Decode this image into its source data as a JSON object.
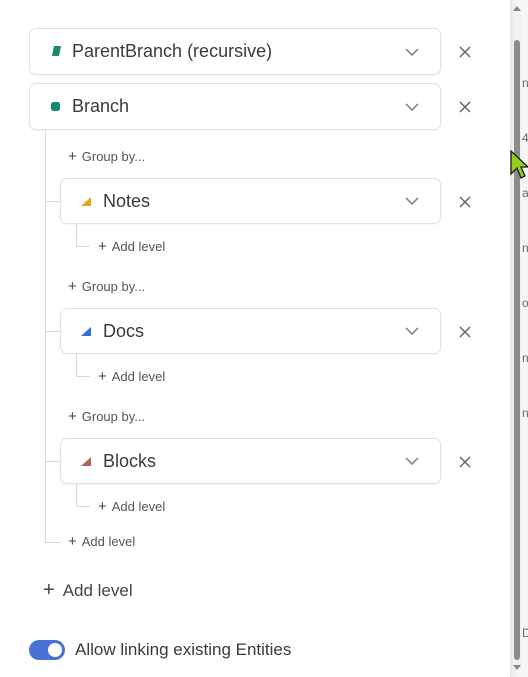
{
  "rows": {
    "parent_branch": {
      "label": "ParentBranch (recursive)",
      "icon": "parentbranch-icon",
      "color": "#1a8a6e"
    },
    "branch": {
      "label": "Branch",
      "icon": "branch-icon",
      "color": "#138a76"
    },
    "notes": {
      "label": "Notes",
      "icon": "notes-icon",
      "color": "#e8a21c"
    },
    "docs": {
      "label": "Docs",
      "icon": "docs-icon",
      "color": "#2f6fd8"
    },
    "blocks": {
      "label": "Blocks",
      "icon": "blocks-icon",
      "color": "#b0615a"
    }
  },
  "group_by_label": "Group by...",
  "add_level_small": "Add level",
  "add_level_main": "Add level",
  "toggle": {
    "label": "Allow linking existing Entities",
    "on": true
  },
  "right_edge_fragments": [
    "n",
    "4",
    "a",
    "n",
    "o",
    "n",
    "n",
    "D"
  ]
}
